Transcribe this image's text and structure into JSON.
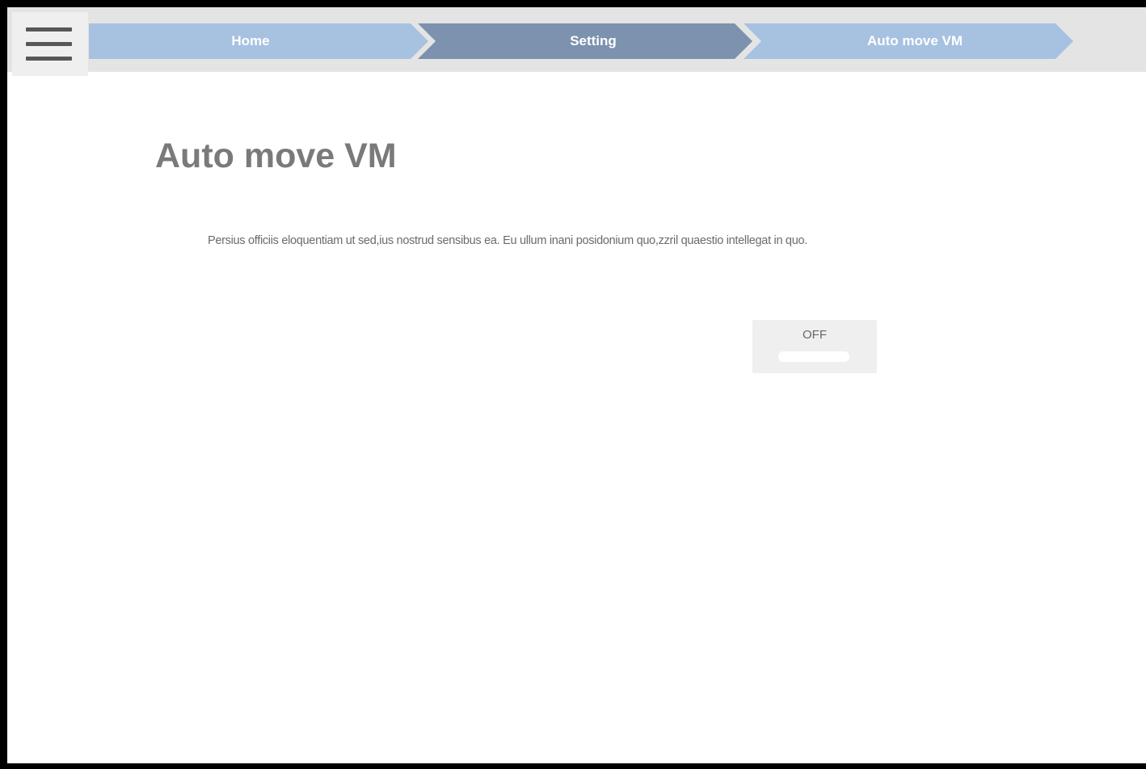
{
  "header": {
    "menu_icon": "hamburger-menu-icon",
    "breadcrumbs": [
      {
        "label": "Home",
        "state": "inactive",
        "color": "#a7c2e0"
      },
      {
        "label": "Setting",
        "state": "active",
        "color": "#7c92ae"
      },
      {
        "label": "Auto move VM",
        "state": "inactive",
        "color": "#a7c2e0"
      }
    ]
  },
  "main": {
    "title": "Auto move VM",
    "description": "Persius officiis eloquentiam ut sed,ius nostrud sensibus ea. Eu ullum inani posidonium quo,zzril quaestio intellegat in quo.",
    "toggle": {
      "label": "OFF",
      "enabled": false
    }
  },
  "colors": {
    "topbar": "#e4e4e4",
    "title": "#7a7a7a",
    "text": "#6b6b6b",
    "frame": "#000000"
  }
}
